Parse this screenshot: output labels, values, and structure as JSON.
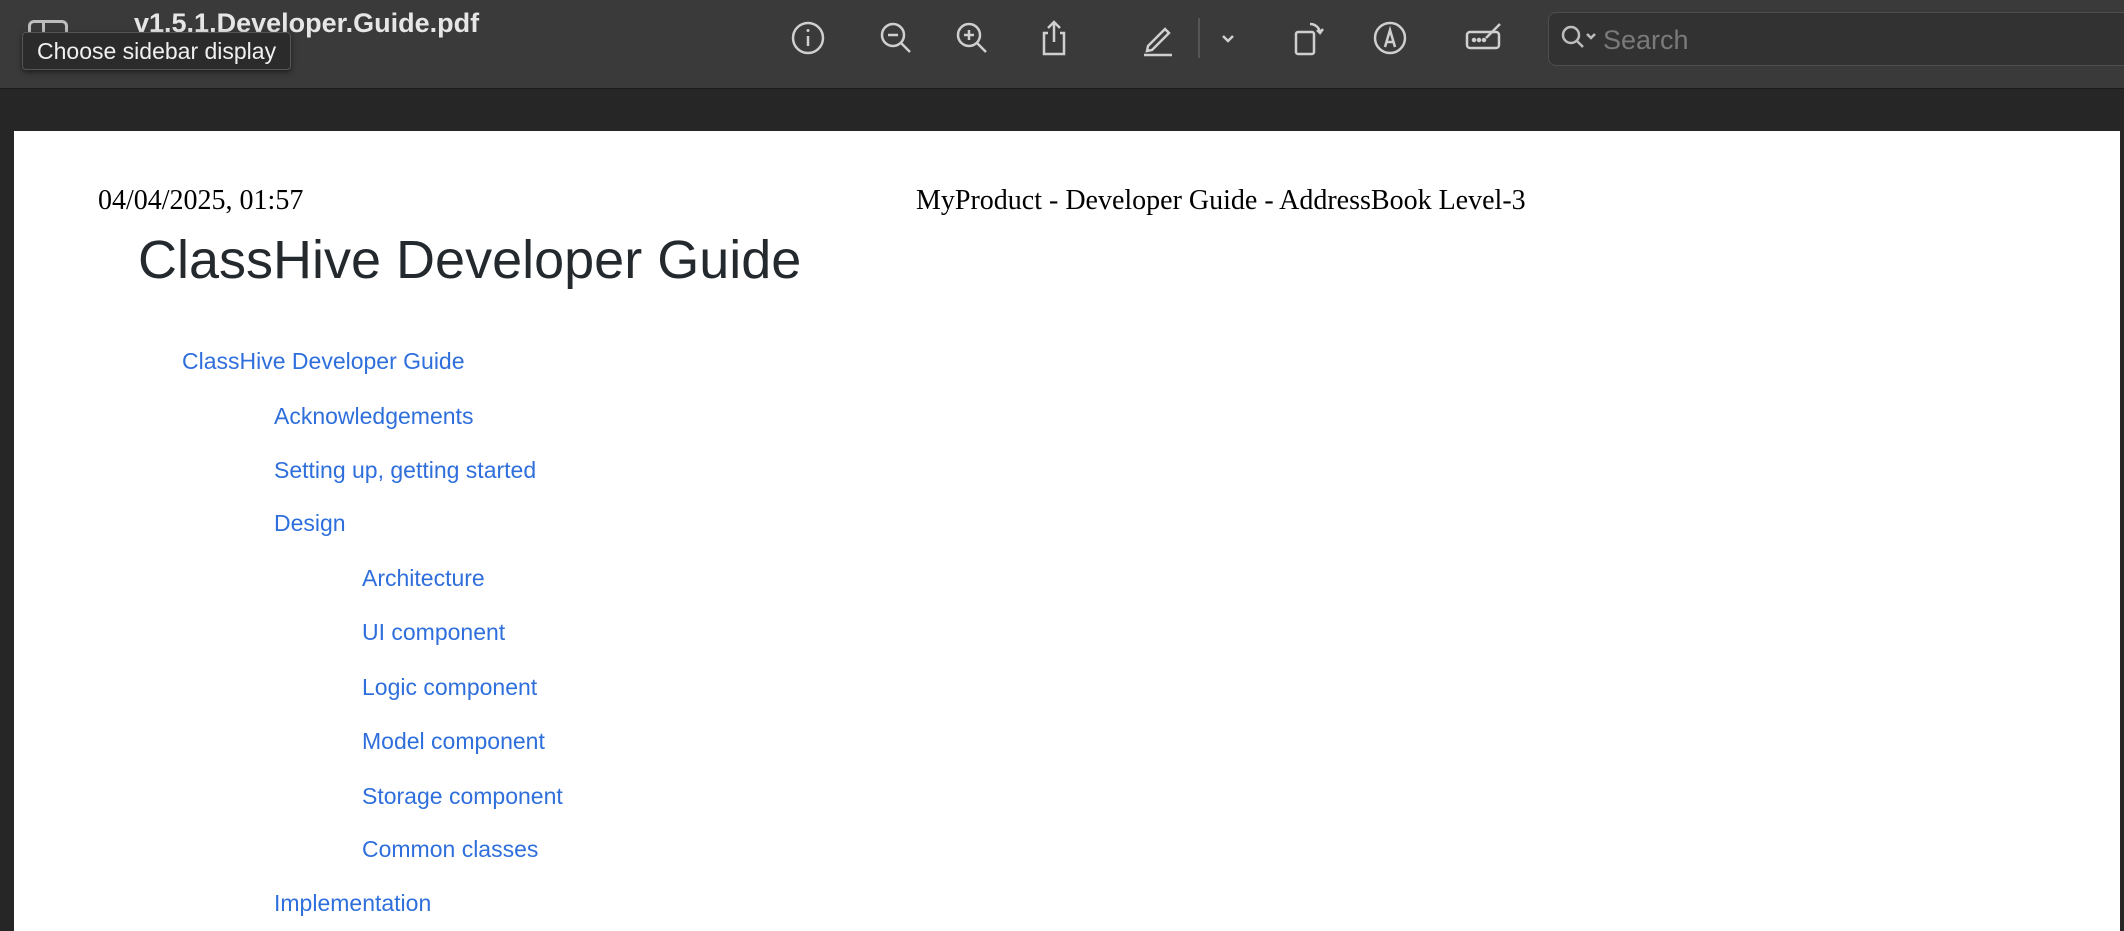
{
  "window": {
    "title": "v1.5.1.Developer.Guide.pdf",
    "tooltip": "Choose sidebar display"
  },
  "toolbar": {
    "icons": [
      "info-icon",
      "zoom-out-icon",
      "zoom-in-icon",
      "share-icon",
      "highlight-icon",
      "chevron-down-icon",
      "rotate-icon",
      "markup-icon",
      "form-fill-icon"
    ],
    "search_placeholder": "Search"
  },
  "page": {
    "print_date": "04/04/2025, 01:57",
    "print_title": "MyProduct - Developer Guide - AddressBook Level-3",
    "heading": "ClassHive Developer Guide",
    "toc": [
      {
        "label": "ClassHive Developer Guide",
        "level": 1
      },
      {
        "label": "Acknowledgements",
        "level": 2
      },
      {
        "label": "Setting up, getting started",
        "level": 2
      },
      {
        "label": "Design",
        "level": 2
      },
      {
        "label": "Architecture",
        "level": 3
      },
      {
        "label": "UI component",
        "level": 3
      },
      {
        "label": "Logic component",
        "level": 3
      },
      {
        "label": "Model component",
        "level": 3
      },
      {
        "label": "Storage component",
        "level": 3
      },
      {
        "label": "Common classes",
        "level": 3
      },
      {
        "label": "Implementation",
        "level": 2
      }
    ]
  },
  "colors": {
    "toolbar_bg": "#3a3a3a",
    "link": "#2f6fdc",
    "heading": "#24292e"
  }
}
